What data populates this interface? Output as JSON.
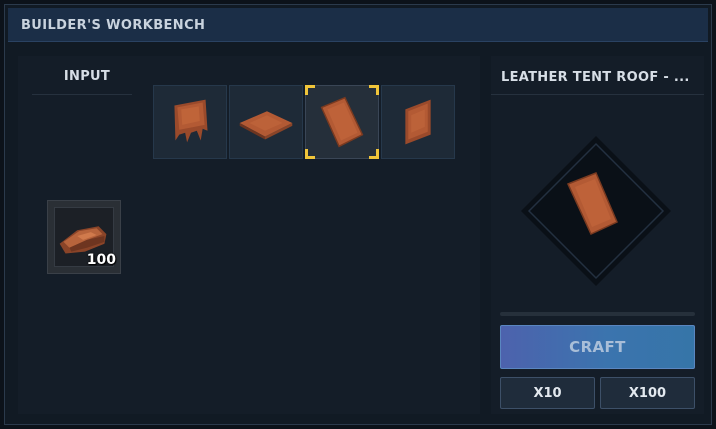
{
  "window": {
    "title": "BUILDER'S WORKBENCH"
  },
  "input": {
    "label": "INPUT",
    "slot": {
      "icon": "leather-scraps-icon",
      "count": "100"
    }
  },
  "recipes": [
    {
      "icon": "leather-wall-icon",
      "selected": false
    },
    {
      "icon": "leather-floor-icon",
      "selected": false
    },
    {
      "icon": "leather-tent-roof-icon",
      "selected": true
    },
    {
      "icon": "leather-panel-icon",
      "selected": false
    }
  ],
  "result": {
    "name": "LEATHER TENT ROOF - ...",
    "icon": "leather-tent-roof-icon"
  },
  "actions": {
    "craft_label": "CRAFT",
    "x10_label": "X10",
    "x100_label": "X100"
  },
  "colors": {
    "accent_yellow": "#f0c53a",
    "craft_button": "#3b74ae",
    "leather": "#b35a34"
  }
}
